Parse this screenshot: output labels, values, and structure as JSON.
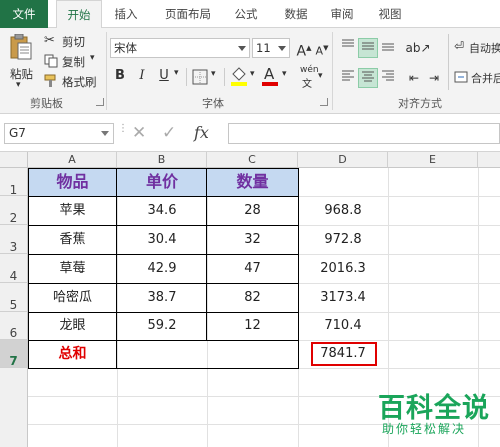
{
  "tabs": [
    "文件",
    "开始",
    "插入",
    "页面布局",
    "公式",
    "数据",
    "审阅",
    "视图"
  ],
  "active_tab": "开始",
  "ribbon": {
    "clipboard": {
      "paste": "粘贴",
      "cut": "剪切",
      "copy": "复制",
      "format_painter": "格式刷",
      "label": "剪贴板"
    },
    "font": {
      "name": "宋体",
      "size": "11",
      "bold": "B",
      "italic": "I",
      "underline": "U",
      "grow": "A",
      "shrink": "A",
      "wen": "wén",
      "label": "字体"
    },
    "alignment": {
      "wrap": "自动换",
      "merge": "合并后",
      "label": "对齐方式"
    }
  },
  "formula_bar": {
    "name_box": "G7",
    "fx": "fx",
    "formula": ""
  },
  "columns": [
    "A",
    "B",
    "C",
    "D",
    "E"
  ],
  "rows": [
    "1",
    "2",
    "3",
    "4",
    "5",
    "6",
    "7"
  ],
  "table": {
    "headers": [
      "物品",
      "单价",
      "数量"
    ],
    "rows": [
      {
        "item": "苹果",
        "price": "34.6",
        "qty": "28",
        "total": "968.8"
      },
      {
        "item": "香蕉",
        "price": "30.4",
        "qty": "32",
        "total": "972.8"
      },
      {
        "item": "草莓",
        "price": "42.9",
        "qty": "47",
        "total": "2016.3"
      },
      {
        "item": "哈密瓜",
        "price": "38.7",
        "qty": "82",
        "total": "3173.4"
      },
      {
        "item": "龙眼",
        "price": "59.2",
        "qty": "12",
        "total": "710.4"
      }
    ],
    "sum_label": "总和",
    "sum_value": "7841.7"
  },
  "watermark": {
    "title": "百科全说",
    "subtitle": "助你轻松解决"
  },
  "colors": {
    "excel_green": "#217346",
    "header_fill": "#c5d9f1",
    "header_text": "#7030a0",
    "total_red": "#e00000",
    "watermark": "#1aa55a"
  }
}
